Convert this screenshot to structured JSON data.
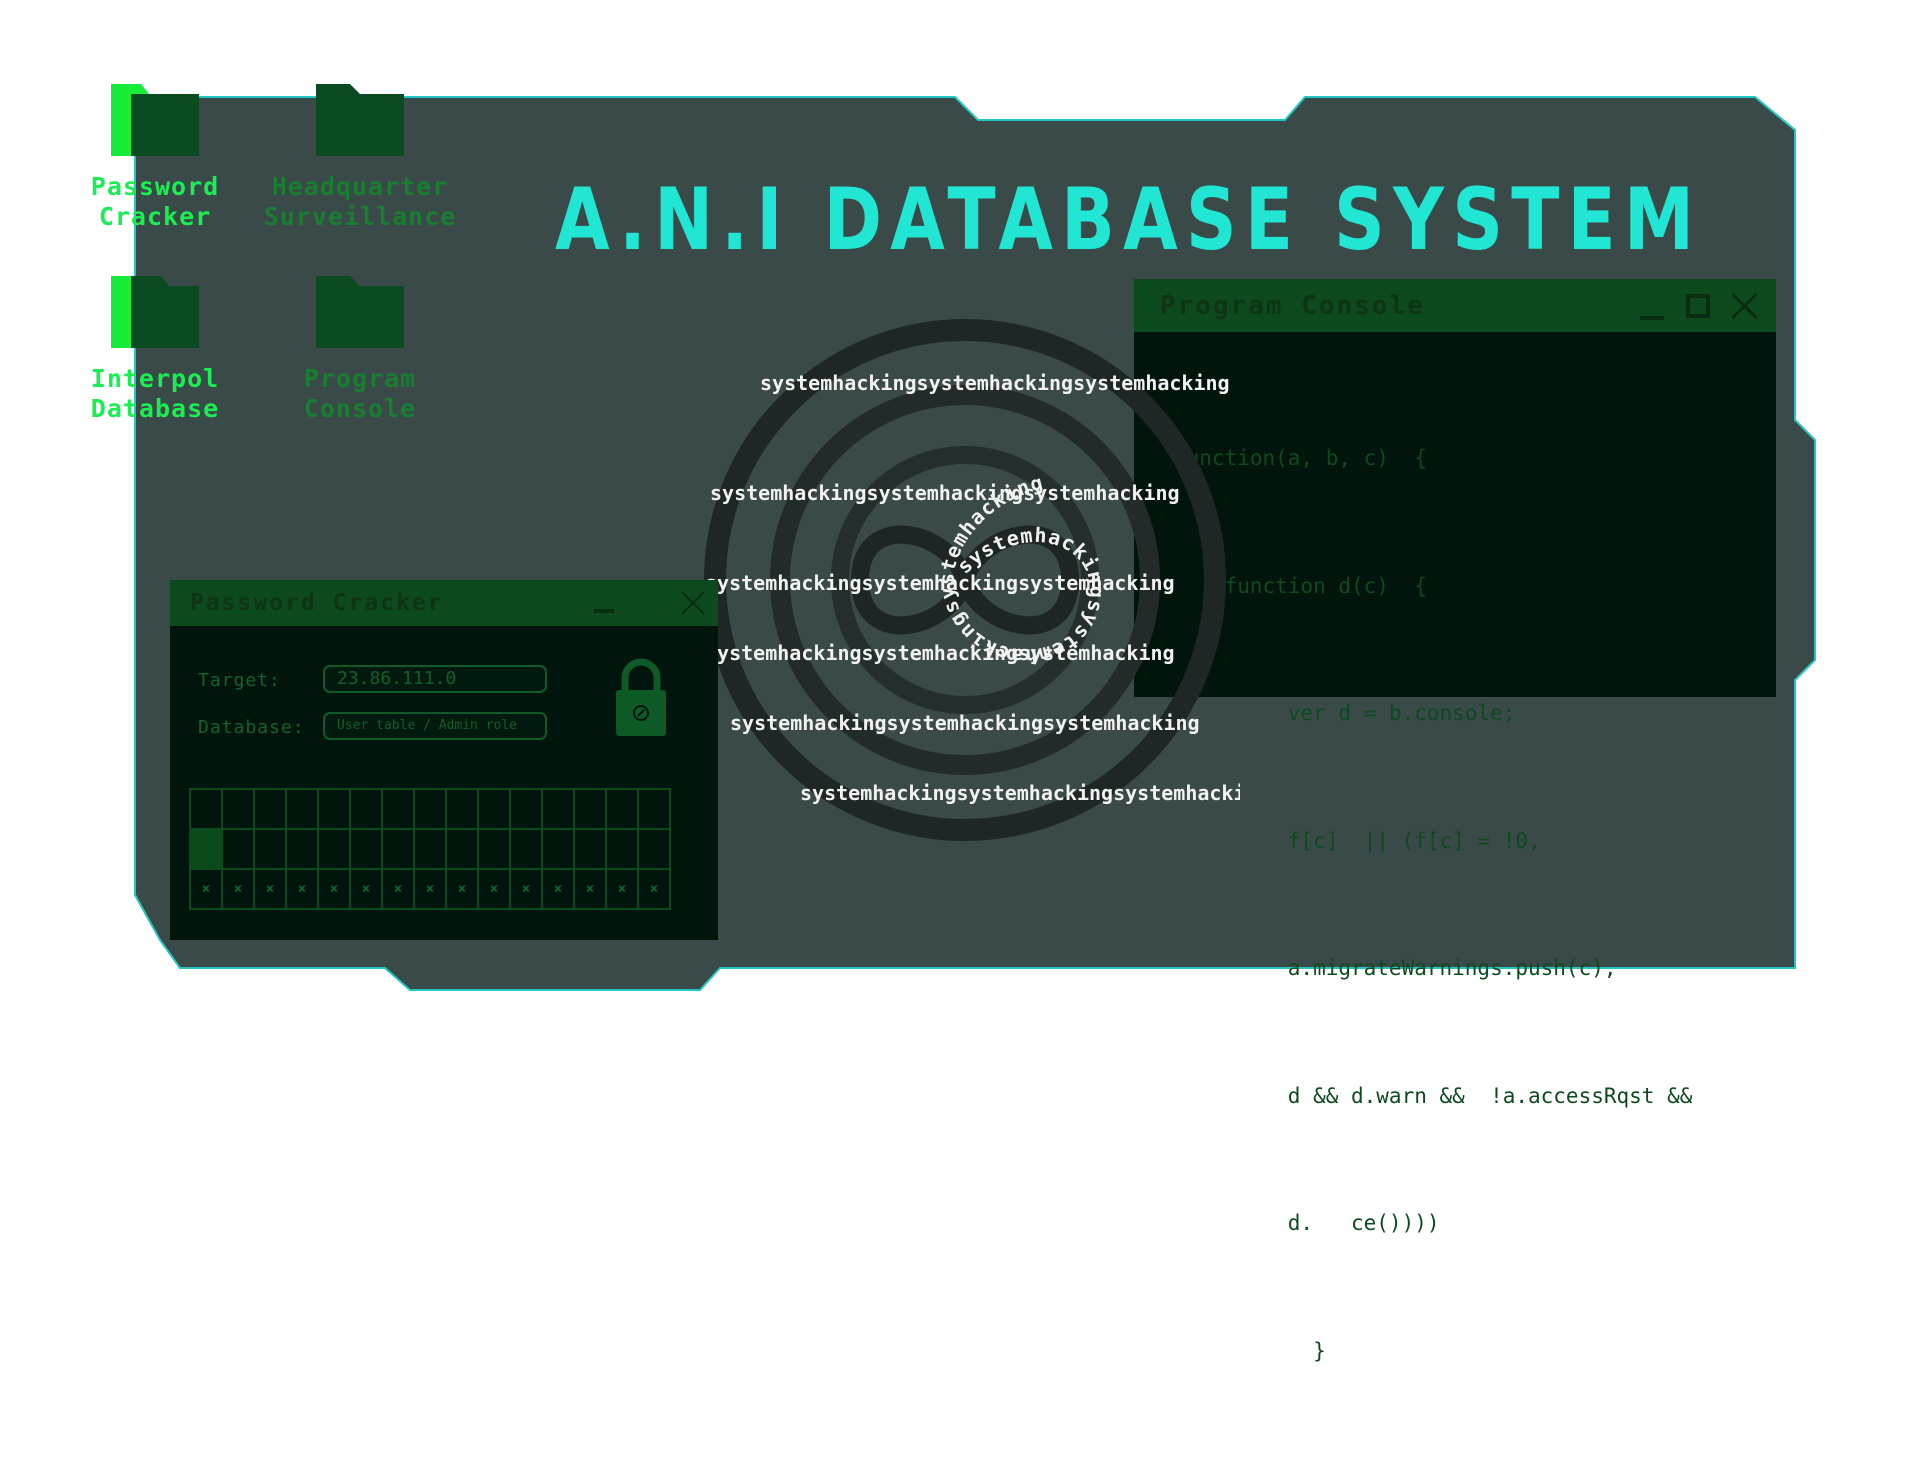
{
  "title": "A.N.I DATABASE SYSTEM",
  "desktop_icons": [
    {
      "label": "Password\nCracker",
      "active": true
    },
    {
      "label": "Headquarter\nSurveillance",
      "active": false
    },
    {
      "label": "Interpol\nDatabase",
      "active": true
    },
    {
      "label": "Program\nConsole",
      "active": false
    }
  ],
  "console": {
    "title": "Program Console",
    "lines": [
      "function(a, b, c)  {",
      "    function d(c)  {",
      "         ver d = b.console;",
      "         f[c]  || (f[c] = !0,",
      "         a.migrateWarnings.push(c),",
      "         d && d.warn &&  !a.accessRqst &&",
      "         d.   ce())))",
      "           }"
    ]
  },
  "password_cracker": {
    "title": "Password Cracker",
    "target_label": "Target:",
    "target_value": "23.86.111.0",
    "database_label": "Database:",
    "database_value": "User table / Admin role",
    "grid_rows": [
      [
        "",
        "",
        "",
        "",
        "",
        "",
        "",
        "",
        "",
        "",
        "",
        "",
        "",
        "",
        ""
      ],
      [
        "",
        "",
        "",
        "",
        "",
        "",
        "",
        "",
        "",
        "",
        "",
        "",
        "",
        "",
        ""
      ],
      [
        "×",
        "×",
        "×",
        "×",
        "×",
        "×",
        "×",
        "×",
        "×",
        "×",
        "×",
        "×",
        "×",
        "×",
        "×"
      ]
    ],
    "filled_cell": [
      1,
      0
    ]
  },
  "spiral_text": "systemhackingsystemhackingsystemhacking",
  "colors": {
    "frame": "#3a4a49",
    "frame_border": "#22c7c2",
    "title": "#22e6d4",
    "folder": "#0b4b21",
    "folder_active": "#18ee3a",
    "console_bg": "#02150c",
    "window_header": "#0c4a1e"
  },
  "icons": [
    "folder-icon",
    "lock-icon",
    "minimize-icon",
    "maximize-icon",
    "close-icon"
  ]
}
